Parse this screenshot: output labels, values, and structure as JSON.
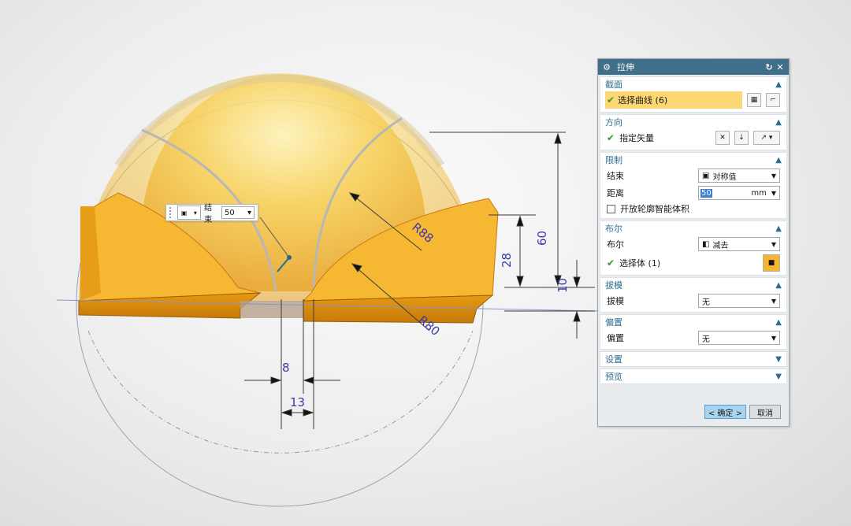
{
  "viewport": {
    "dimensions": {
      "d_60": "60",
      "d_28": "28",
      "d_10": "10",
      "d_8": "8",
      "d_13": "13",
      "r_88": "R88",
      "r_80": "R80"
    },
    "float_toolbar": {
      "label": "结束",
      "value": "50",
      "type_icon": "cube-icon"
    }
  },
  "dialog": {
    "title": "拉伸",
    "icons": {
      "title": "gear-icon",
      "reset": "reset-icon",
      "close": "close-icon"
    },
    "sections": {
      "section": {
        "title": "截面",
        "select_curve": "选择曲线 (6)"
      },
      "direction": {
        "title": "方向",
        "vector": "指定矢量"
      },
      "limits": {
        "title": "限制",
        "end_label": "结束",
        "end_value": "对称值",
        "distance_label": "距离",
        "distance_value": "50",
        "distance_unit": "mm",
        "open_profile": "开放轮廓智能体积"
      },
      "boolean": {
        "title": "布尔",
        "bool_label": "布尔",
        "bool_value": "减去",
        "select_body": "选择体 (1)"
      },
      "draft": {
        "title": "拔模",
        "draft_label": "拔模",
        "draft_value": "无"
      },
      "offset": {
        "title": "偏置",
        "offset_label": "偏置",
        "offset_value": "无"
      },
      "settings": {
        "title": "设置"
      },
      "preview": {
        "title": "预览"
      }
    },
    "buttons": {
      "ok": "< 确定 >",
      "cancel": "取消"
    }
  },
  "colors": {
    "title_bar": "#3f6f8a",
    "section_header": "#2e6d93",
    "highlight": "#fcd774",
    "solid_orange": "#f0a81c",
    "sphere_yellow": "#f6c84a",
    "dimension_blue": "#3a3aa8"
  }
}
